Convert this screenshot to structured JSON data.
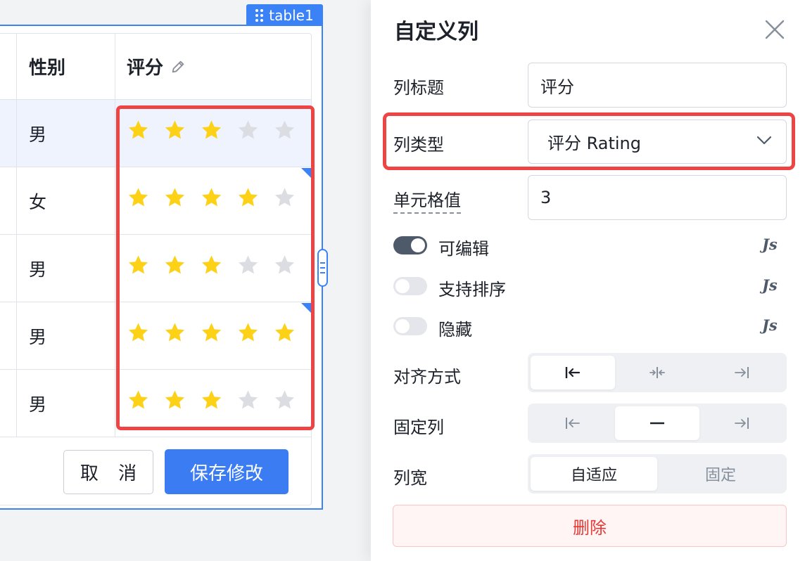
{
  "table": {
    "tag_label": "table1",
    "headers": {
      "gender": "性别",
      "rating": "评分"
    },
    "rows": [
      {
        "gender": "男",
        "rating": 3,
        "edited": false
      },
      {
        "gender": "女",
        "rating": 4,
        "edited": true
      },
      {
        "gender": "男",
        "rating": 3,
        "edited": false
      },
      {
        "gender": "男",
        "rating": 5,
        "edited": true
      },
      {
        "gender": "男",
        "rating": 3,
        "edited": false
      }
    ],
    "max_stars": 5,
    "cancel_label": "取 消",
    "save_label": "保存修改"
  },
  "panel": {
    "title": "自定义列",
    "fields": {
      "column_title_label": "列标题",
      "column_title_value": "评分",
      "column_type_label": "列类型",
      "column_type_value": "评分 Rating",
      "cell_value_label": "单元格值",
      "cell_value_value": "3"
    },
    "toggles": [
      {
        "label": "可编辑",
        "on": true,
        "js": "Js"
      },
      {
        "label": "支持排序",
        "on": false,
        "js": "Js"
      },
      {
        "label": "隐藏",
        "on": false,
        "js": "Js"
      }
    ],
    "align_label": "对齐方式",
    "fixed_label": "固定列",
    "width_label": "列宽",
    "width_options": [
      "自适应",
      "固定"
    ],
    "delete_label": "删除"
  },
  "colors": {
    "accent": "#3b82f6",
    "highlight": "#ef4444",
    "star_filled": "#fcd116",
    "star_empty": "#dcdde3"
  }
}
